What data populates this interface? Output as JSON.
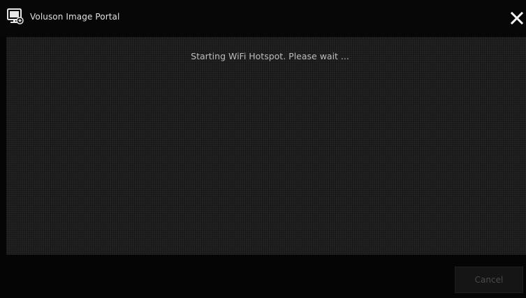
{
  "window": {
    "title": "Voluson Image Portal",
    "icon": "portal-monitor-icon",
    "close_icon": "close-icon"
  },
  "main": {
    "status_message": "Starting WiFi Hotspot. Please wait ..."
  },
  "footer": {
    "cancel_label": "Cancel",
    "cancel_enabled": false
  },
  "colors": {
    "background": "#050505",
    "panel": "#1e1e1e",
    "title_text": "#e0e0e0",
    "status_text": "#bdbdbd",
    "disabled_text": "#4a4a4a"
  }
}
